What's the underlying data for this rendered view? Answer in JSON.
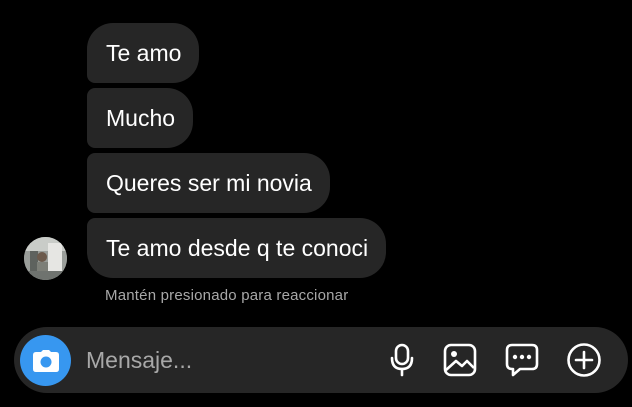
{
  "chat": {
    "messages": [
      {
        "text": "Te amo"
      },
      {
        "text": "Mucho"
      },
      {
        "text": "Queres ser mi novia"
      },
      {
        "text": "Te amo desde q te conoci"
      }
    ],
    "reaction_hint": "Mantén presionado para reaccionar"
  },
  "composer": {
    "placeholder": "Mensaje...",
    "icons": {
      "camera": "camera-icon",
      "mic": "microphone-icon",
      "gallery": "image-icon",
      "sticker": "chat-bubble-dots-icon",
      "add": "plus-circle-icon"
    }
  },
  "colors": {
    "background": "#000000",
    "bubble": "#262626",
    "text": "#ffffff",
    "muted_text": "#a8a8a8",
    "accent": "#3797f0"
  }
}
